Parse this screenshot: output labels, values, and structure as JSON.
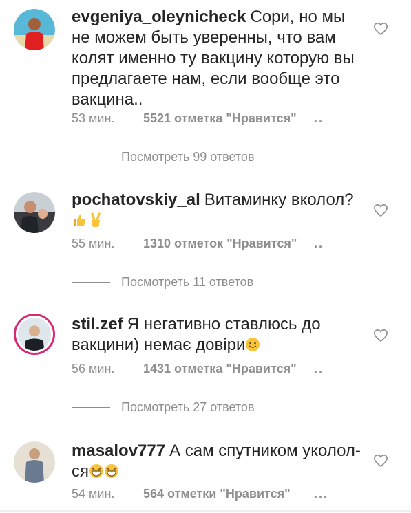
{
  "comments": [
    {
      "username": "evgeniya_oleynicheck",
      "text": "Сори, но мы не можем быть уверенны, что вам колят именно ту вакцину которую вы предлагаете нам, если вообще это вакцина..",
      "time": "53 мин.",
      "likes": "5521 отметка \"Нравится\"",
      "more": "..",
      "replies": "Посмотреть 99 ответов",
      "emoji": []
    },
    {
      "username": "pochatovskiy_al",
      "text": "Витаминку вколол?",
      "time": "55 мин.",
      "likes": "1310 отметок \"Нравится\"",
      "more": "..",
      "replies": "Посмотреть 11 ответов",
      "emoji": [
        "thumbs-up",
        "victory-hand"
      ]
    },
    {
      "username": "stil.zef",
      "text": "Я негативно ставлюсь до вакцини) немає довіри",
      "time": "56 мин.",
      "likes": "1431 отметка \"Нравится\"",
      "more": "..",
      "replies": "Посмотреть 27 ответов",
      "emoji": [
        "smiling-face"
      ]
    },
    {
      "username": "masalov777",
      "text": "А сам спутником уколол­ся",
      "time": "54 мин.",
      "likes": "564 отметки \"Нравится\"",
      "more": "...",
      "emoji": [
        "grinning-face",
        "grinning-face"
      ]
    }
  ],
  "colors": {
    "text": "#262626",
    "secondary": "#8e8e8e",
    "story_ring": "#d62976"
  },
  "icons": {
    "like": "heart-outline-icon"
  }
}
